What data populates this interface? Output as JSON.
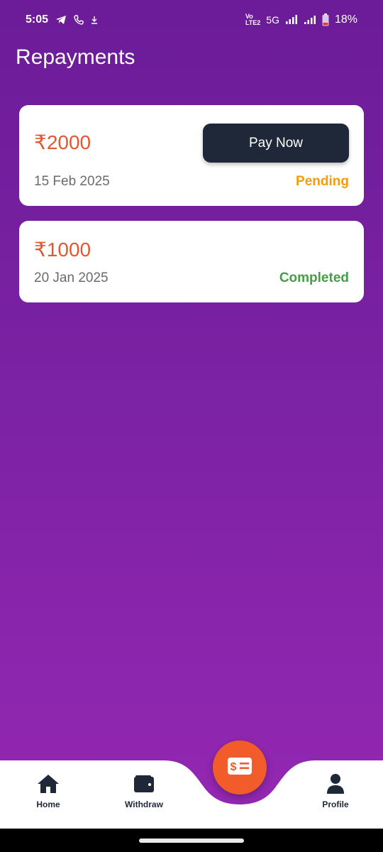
{
  "status_bar": {
    "time": "5:05",
    "network_label": "5G",
    "volte_label": "VoLTE2",
    "battery": "18%",
    "icons": [
      "telegram-icon",
      "phone-icon",
      "download-icon",
      "signal-icon",
      "battery-icon"
    ]
  },
  "page": {
    "title": "Repayments"
  },
  "repayments": [
    {
      "amount": "₹2000",
      "date": "15 Feb 2025",
      "status": "Pending",
      "action_label": "Pay Now"
    },
    {
      "amount": "₹1000",
      "date": "20 Jan 2025",
      "status": "Completed"
    }
  ],
  "nav": {
    "home_label": "Home",
    "withdraw_label": "Withdraw",
    "profile_label": "Profile",
    "fab_icon": "repay-icon"
  },
  "colors": {
    "accent": "#f25b2a",
    "pending": "#f29c0e",
    "completed": "#43a047",
    "button": "#1e2838"
  }
}
